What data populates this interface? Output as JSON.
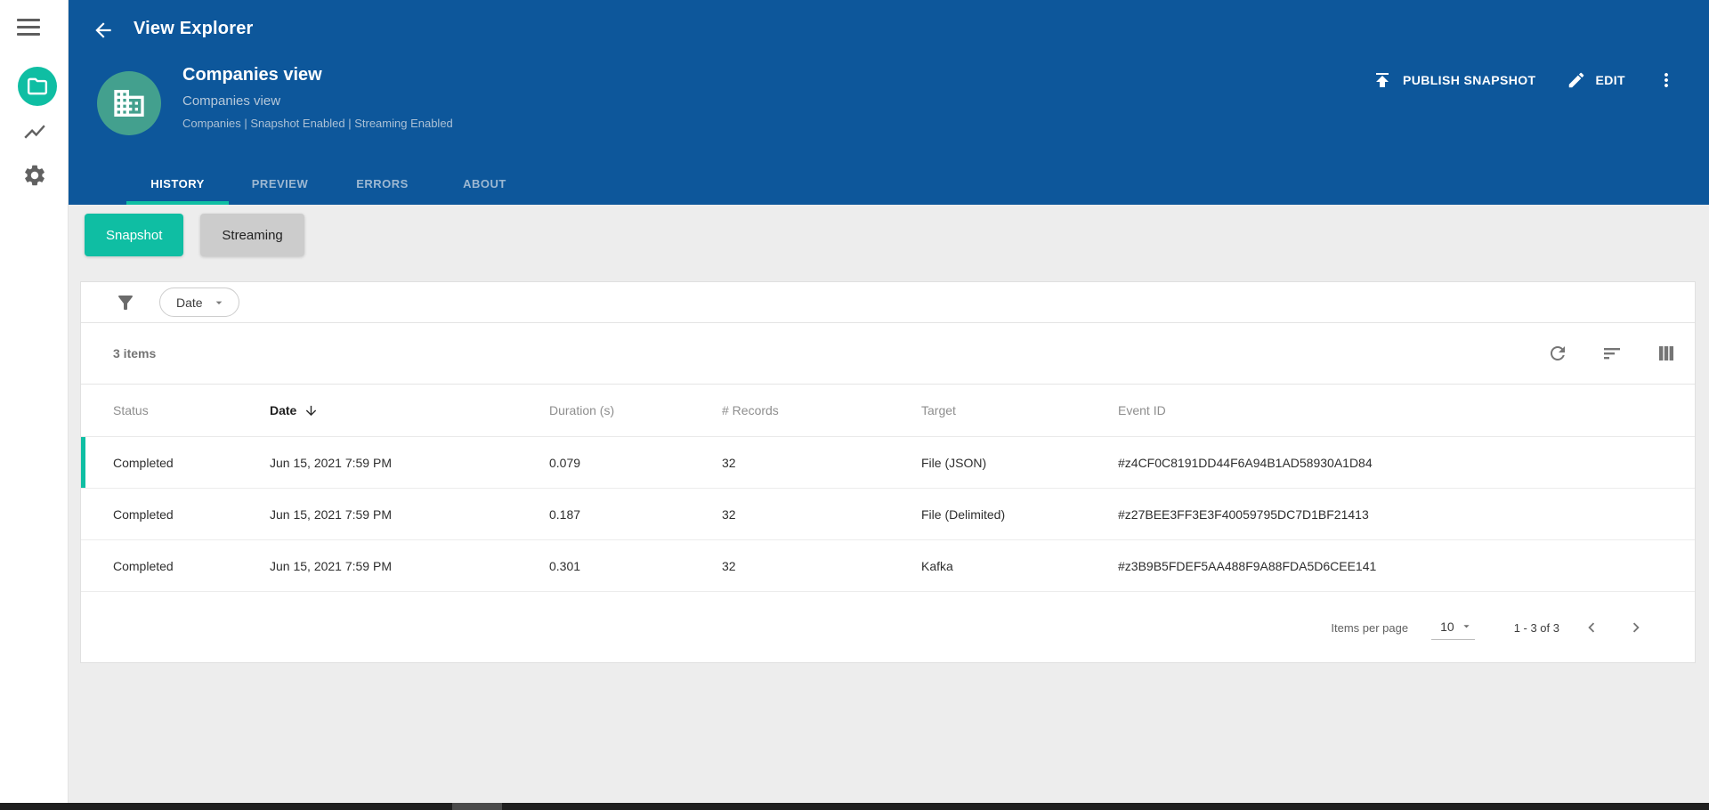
{
  "colors": {
    "header_blue": "#0D579B",
    "accent_teal": "#0FBEA3",
    "avatar_green": "#43A08E"
  },
  "topbar": {
    "title": "View Explorer"
  },
  "view_header": {
    "title": "Companies view",
    "subtitle": "Companies view",
    "meta": "Companies | Snapshot Enabled | Streaming Enabled",
    "publish_label": "PUBLISH SNAPSHOT",
    "edit_label": "EDIT"
  },
  "tabs": [
    {
      "label": "HISTORY",
      "active": true
    },
    {
      "label": "PREVIEW",
      "active": false
    },
    {
      "label": "ERRORS",
      "active": false
    },
    {
      "label": "ABOUT",
      "active": false
    }
  ],
  "mode_toggle": [
    {
      "label": "Snapshot",
      "active": true
    },
    {
      "label": "Streaming",
      "active": false
    }
  ],
  "filter_bar": {
    "chip_label": "Date"
  },
  "list_toolbar": {
    "count": "3 items"
  },
  "table": {
    "columns": [
      "Status",
      "Date",
      "Duration (s)",
      "# Records",
      "Target",
      "Event ID"
    ],
    "sort_column": "Date",
    "sort_direction": "desc",
    "rows": [
      {
        "status": "Completed",
        "date": "Jun 15, 2021 7:59 PM",
        "duration": "0.079",
        "records": "32",
        "target": "File (JSON)",
        "event_id": "#z4CF0C8191DD44F6A94B1AD58930A1D84",
        "selected": true
      },
      {
        "status": "Completed",
        "date": "Jun 15, 2021 7:59 PM",
        "duration": "0.187",
        "records": "32",
        "target": "File (Delimited)",
        "event_id": "#z27BEE3FF3E3F40059795DC7D1BF21413",
        "selected": false
      },
      {
        "status": "Completed",
        "date": "Jun 15, 2021 7:59 PM",
        "duration": "0.301",
        "records": "32",
        "target": "Kafka",
        "event_id": "#z3B9B5FDEF5AA488F9A88FDA5D6CEE141",
        "selected": false
      }
    ]
  },
  "pagination": {
    "label": "Items per page",
    "page_size": "10",
    "range": "1 - 3 of 3"
  }
}
